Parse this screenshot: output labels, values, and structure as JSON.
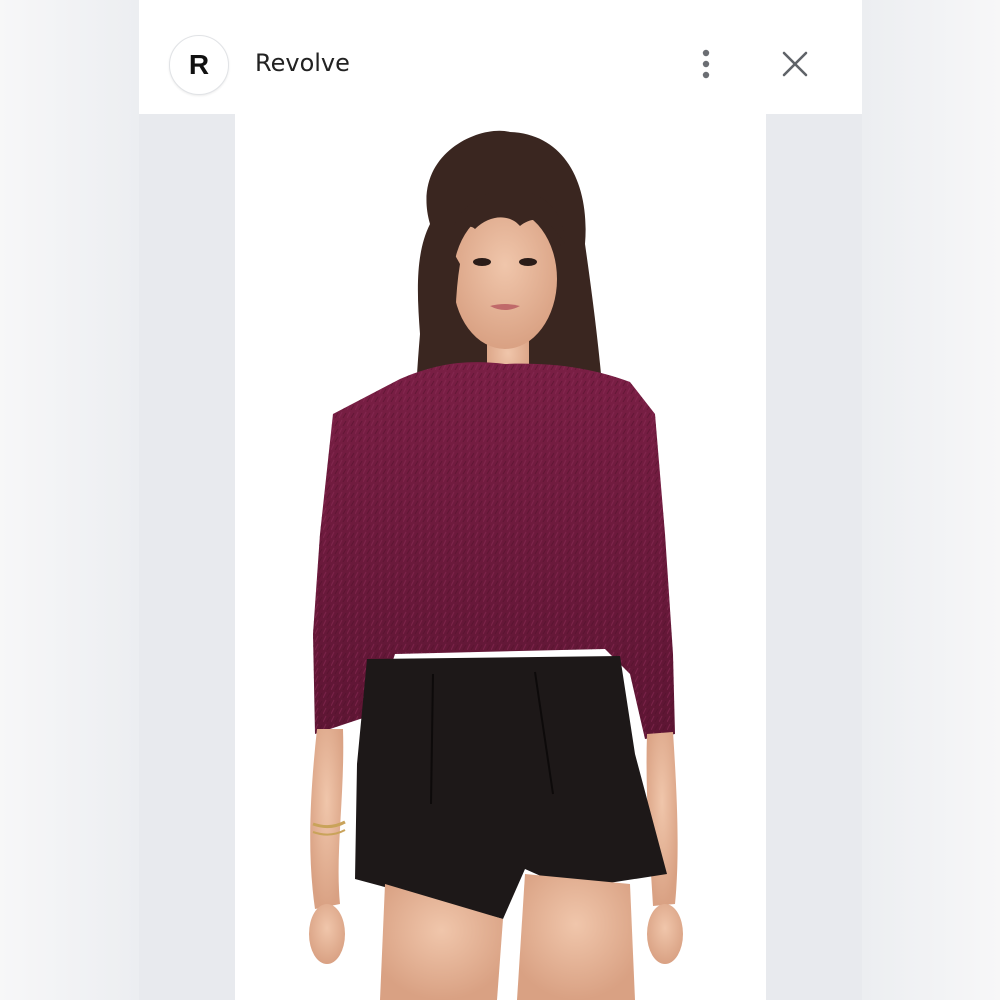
{
  "header": {
    "logo_letter": "R",
    "site_name": "Revolve",
    "menu_icon": "more-vertical-icon",
    "close_icon": "close-icon"
  },
  "image": {
    "subject": "product-photo",
    "colors": {
      "sweater": "#6e1a3c",
      "shorts": "#1d1818",
      "hair": "#3a2620",
      "skin": "#e8b89c",
      "background": "#ffffff"
    }
  }
}
